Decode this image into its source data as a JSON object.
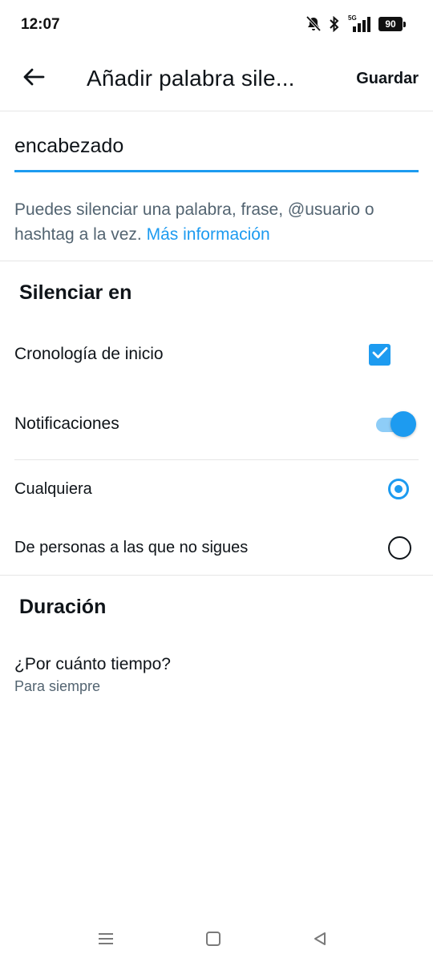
{
  "status_bar": {
    "time": "12:07",
    "network": "5G",
    "battery": "90",
    "icons": [
      "notifications-muted-icon",
      "bluetooth-icon",
      "signal-5g-icon",
      "battery-icon"
    ]
  },
  "header": {
    "title": "Añadir palabra sile...",
    "save_label": "Guardar",
    "back_icon": "arrow-left-icon"
  },
  "input": {
    "value": "encabezado"
  },
  "helper": {
    "text": "Puedes silenciar una palabra, frase, @usuario o hashtag a la vez. ",
    "link": "Más información"
  },
  "mute_in": {
    "title": "Silenciar en",
    "home_timeline": {
      "label": "Cronología de inicio",
      "checked": true
    },
    "notifications": {
      "label": "Notificaciones",
      "enabled": true
    },
    "options": [
      {
        "label": "Cualquiera",
        "selected": true
      },
      {
        "label": "De personas a las que no sigues",
        "selected": false
      }
    ]
  },
  "duration": {
    "title": "Duración",
    "question": "¿Por cuánto tiempo?",
    "value": "Para siempre"
  },
  "nav": {
    "icons": [
      "recent-apps-icon",
      "home-icon",
      "back-icon"
    ]
  },
  "colors": {
    "accent": "#1d9bf0",
    "accent_light": "#8ecdf7",
    "text": "#0f1419",
    "secondary_text": "#536471"
  }
}
